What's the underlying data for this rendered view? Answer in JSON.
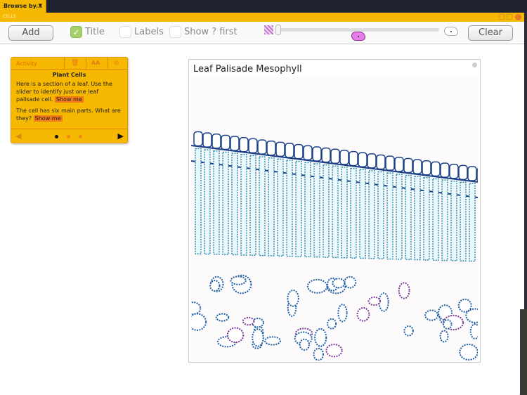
{
  "topbar": {
    "browse_label": "Browse by...",
    "browse_caret": "▼"
  },
  "window": {
    "title": "CELLS"
  },
  "toolbar": {
    "add_label": "Add",
    "title_check": {
      "label": "Title",
      "checked": true
    },
    "labels_check": {
      "label": "Labels",
      "checked": false
    },
    "show_first_check": {
      "label": "Show ? first",
      "checked": false
    },
    "zoom_slider": {
      "value": 0.0,
      "min_icon": "tissue-texture-icon",
      "max_icon": "single-cell-icon"
    },
    "clear_label": "Clear"
  },
  "activity": {
    "header_label": "Activity",
    "title": "Plant Cells",
    "paragraph1": "Here is a section of a leaf. Use the slider to identify just one leaf palisade cell.",
    "paragraph2": "The cell has six main parts. What are they?",
    "show_me_label": "Show me",
    "pages": 3,
    "current_page": 1,
    "prev": "◀",
    "next": "▶",
    "font_size_label": "AA"
  },
  "card": {
    "title": "Leaf Palisade Mesophyll",
    "image": "leaf palisade mesophyll micrograph"
  },
  "colors": {
    "accent": "#f6b800",
    "show_me": "#f27a1a",
    "check_on": "#a5cf6b",
    "pink_cell": "#e77de8"
  }
}
